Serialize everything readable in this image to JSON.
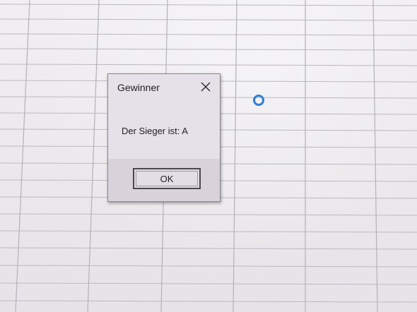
{
  "dialog": {
    "title": "Gewinner",
    "message": "Der Sieger ist: A",
    "ok_label": "OK",
    "close_glyph": "close-icon"
  },
  "cursor": {
    "icon": "busy-cursor-icon",
    "color": "#2e7fd6"
  },
  "spreadsheet": {
    "grid_color": "#b9b5bd",
    "background": "#ece9ec"
  }
}
